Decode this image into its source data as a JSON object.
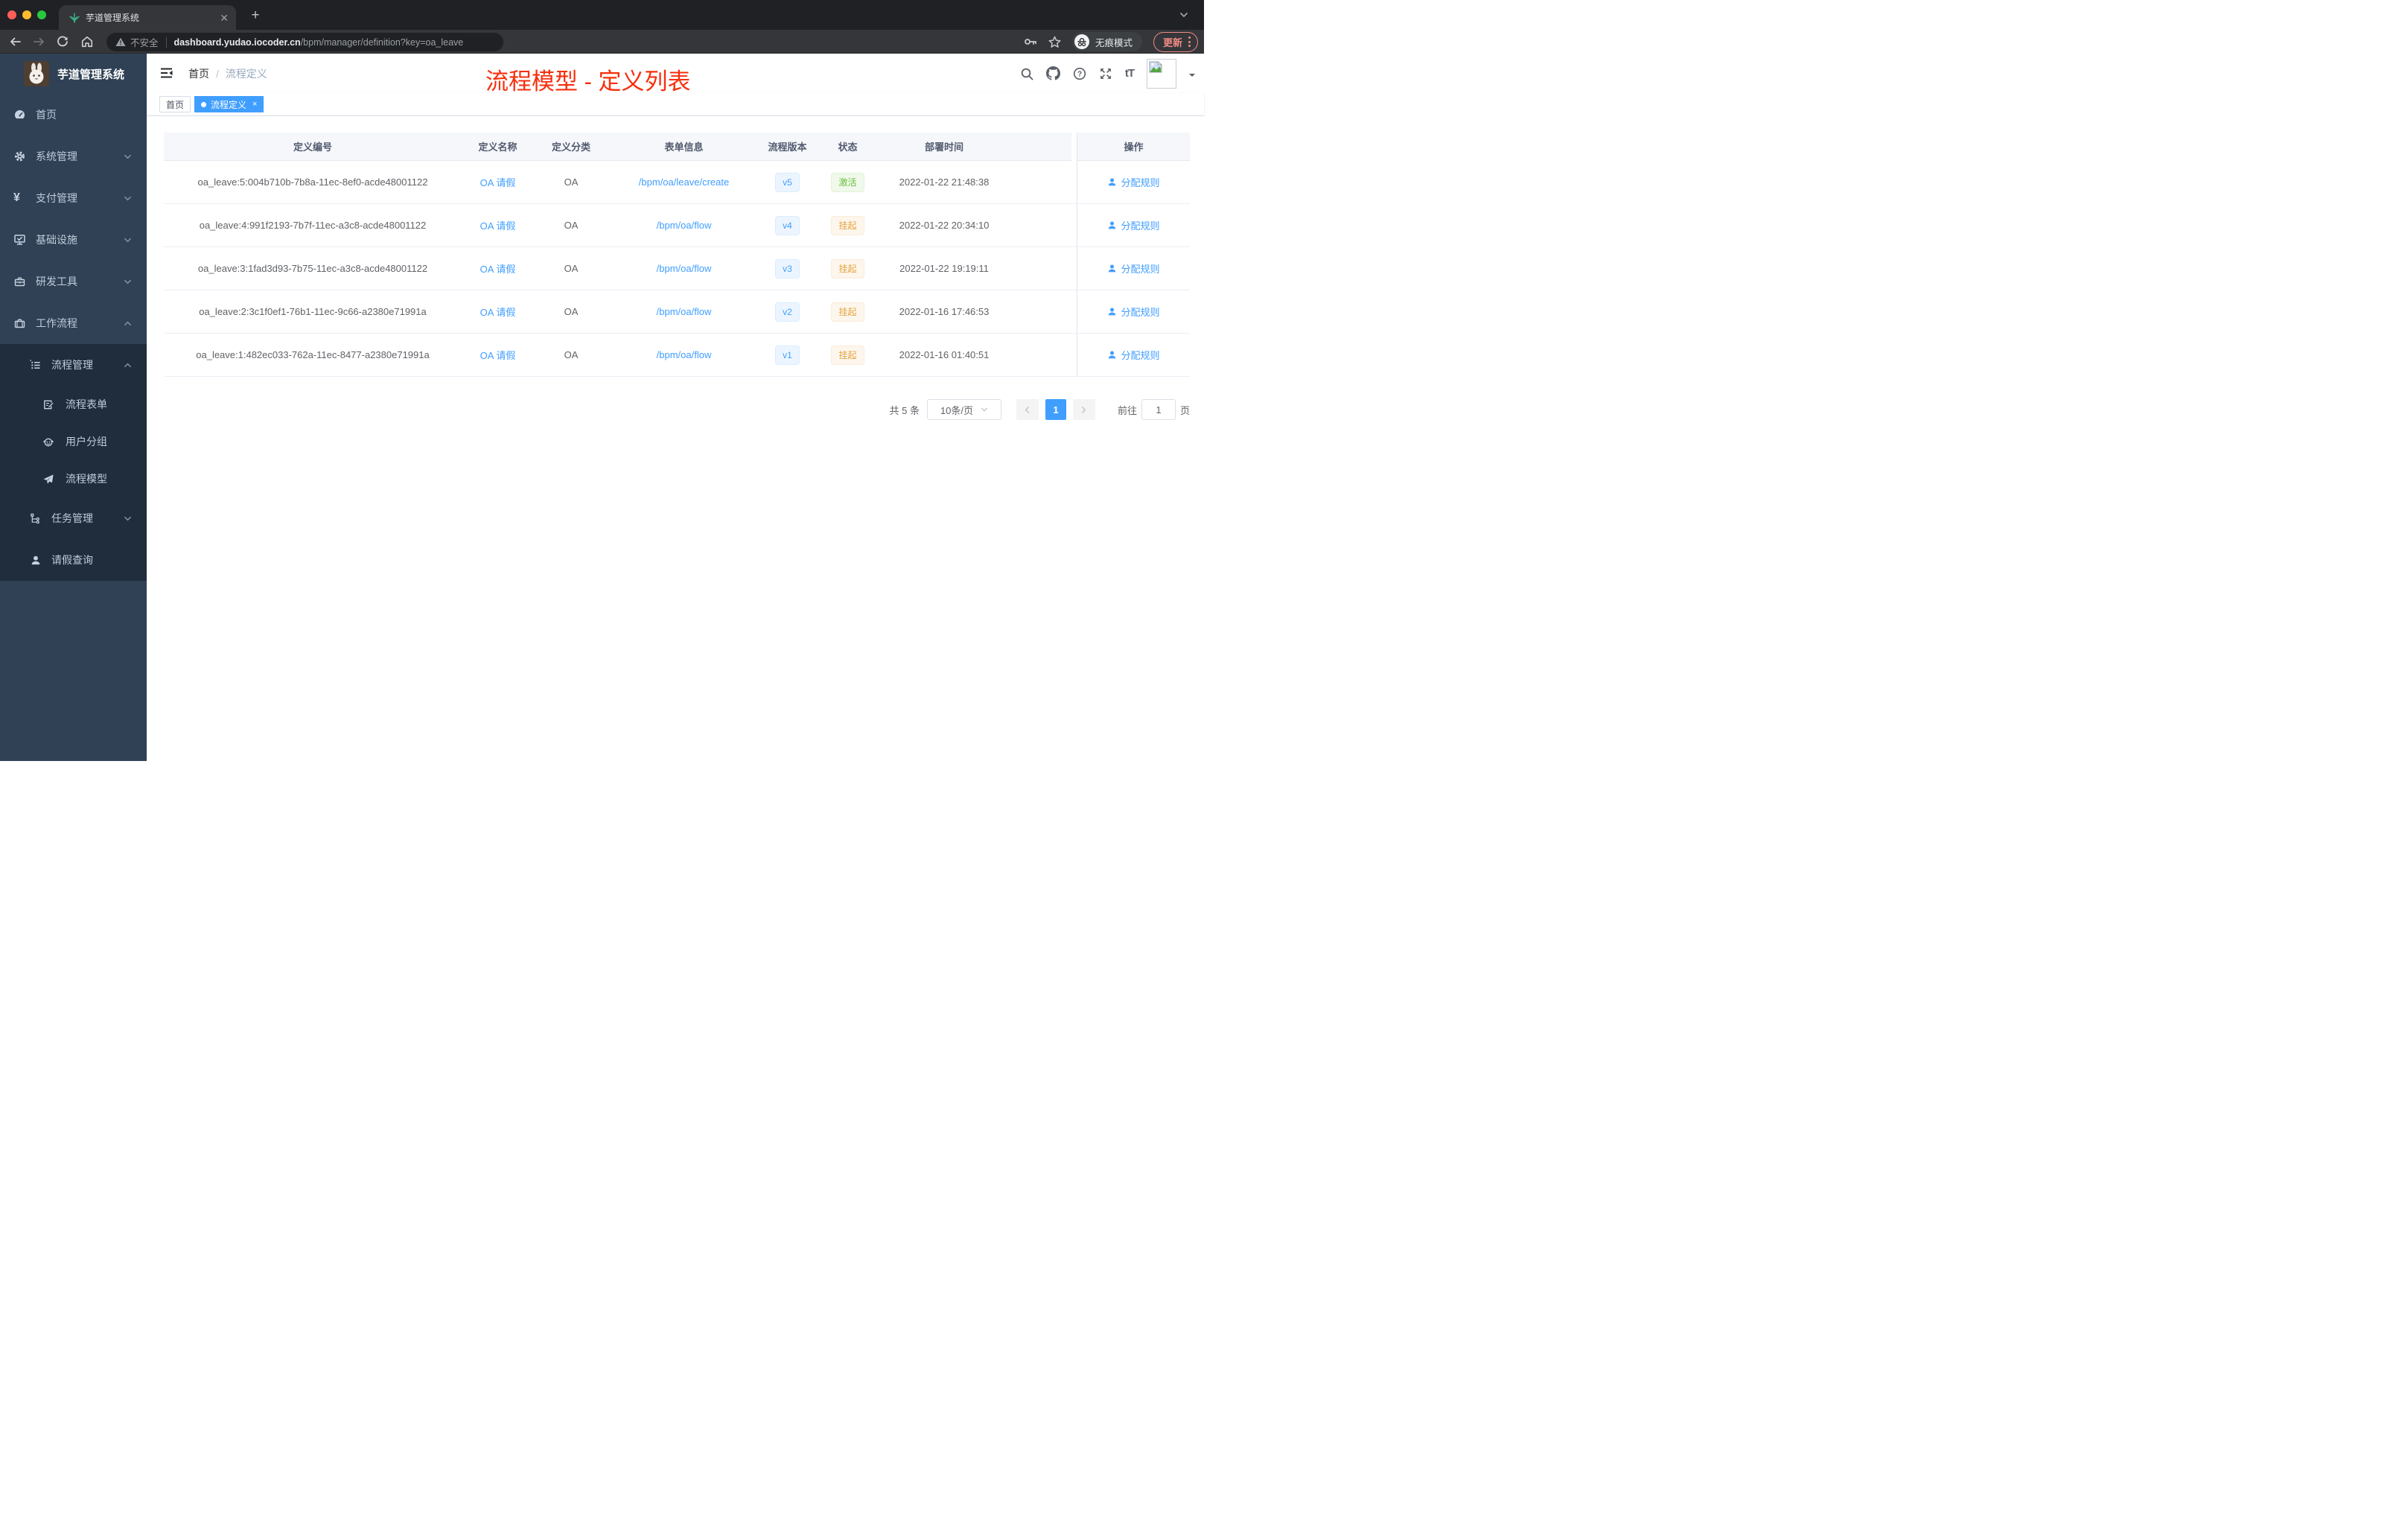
{
  "browser": {
    "tab_title": "芋道管理系统",
    "security_label": "不安全",
    "url_host": "dashboard.yudao.iocoder.cn",
    "url_path": "/bpm/manager/definition?key=oa_leave",
    "incognito_label": "无痕模式",
    "update_label": "更新"
  },
  "sidebar": {
    "app_title": "芋道管理系统",
    "items": [
      {
        "label": "首页",
        "icon": "dashboard-icon"
      },
      {
        "label": "系统管理",
        "icon": "gear-icon",
        "expand": "down"
      },
      {
        "label": "支付管理",
        "icon": "yen-icon",
        "expand": "down"
      },
      {
        "label": "基础设施",
        "icon": "monitor-check-icon",
        "expand": "down"
      },
      {
        "label": "研发工具",
        "icon": "toolbox-icon",
        "expand": "down"
      },
      {
        "label": "工作流程",
        "icon": "briefcase-icon",
        "expand": "up"
      },
      {
        "label": "流程管理",
        "icon": "list-icon",
        "expand": "up"
      },
      {
        "label": "流程表单",
        "icon": "form-edit-icon"
      },
      {
        "label": "用户分组",
        "icon": "robot-icon"
      },
      {
        "label": "流程模型",
        "icon": "paper-plane-icon"
      },
      {
        "label": "任务管理",
        "icon": "tree-icon",
        "expand": "down"
      },
      {
        "label": "请假查询",
        "icon": "user-icon"
      }
    ]
  },
  "navbar": {
    "breadcrumb": [
      "首页",
      "流程定义"
    ],
    "breadcrumb_separator": "/",
    "font_size_icon_label": "tT",
    "overlay_title": "流程模型 - 定义列表"
  },
  "tags": [
    {
      "label": "首页",
      "active": false
    },
    {
      "label": "流程定义",
      "active": true,
      "close": "×"
    }
  ],
  "table": {
    "columns": [
      "定义编号",
      "定义名称",
      "定义分类",
      "表单信息",
      "流程版本",
      "状态",
      "部署时间",
      "操作"
    ],
    "action_label": "分配规则",
    "rows": [
      {
        "id": "oa_leave:5:004b710b-7b8a-11ec-8ef0-acde48001122",
        "name": "OA 请假",
        "category": "OA",
        "form": "/bpm/oa/leave/create",
        "version": "v5",
        "status": "激活",
        "status_type": "success",
        "deployed": "2022-01-22 21:48:38"
      },
      {
        "id": "oa_leave:4:991f2193-7b7f-11ec-a3c8-acde48001122",
        "name": "OA 请假",
        "category": "OA",
        "form": "/bpm/oa/flow",
        "version": "v4",
        "status": "挂起",
        "status_type": "warning",
        "deployed": "2022-01-22 20:34:10"
      },
      {
        "id": "oa_leave:3:1fad3d93-7b75-11ec-a3c8-acde48001122",
        "name": "OA 请假",
        "category": "OA",
        "form": "/bpm/oa/flow",
        "version": "v3",
        "status": "挂起",
        "status_type": "warning",
        "deployed": "2022-01-22 19:19:11"
      },
      {
        "id": "oa_leave:2:3c1f0ef1-76b1-11ec-9c66-a2380e71991a",
        "name": "OA 请假",
        "category": "OA",
        "form": "/bpm/oa/flow",
        "version": "v2",
        "status": "挂起",
        "status_type": "warning",
        "deployed": "2022-01-16 17:46:53"
      },
      {
        "id": "oa_leave:1:482ec033-762a-11ec-8477-a2380e71991a",
        "name": "OA 请假",
        "category": "OA",
        "form": "/bpm/oa/flow",
        "version": "v1",
        "status": "挂起",
        "status_type": "warning",
        "deployed": "2022-01-16 01:40:51"
      }
    ]
  },
  "pagination": {
    "total": "共 5 条",
    "page_size": "10条/页",
    "current_page": "1",
    "goto_label": "前往",
    "goto_value": "1",
    "unit": "页"
  },
  "colors": {
    "accent": "#409eff",
    "success": "#67c23a",
    "warning": "#e6a23c",
    "sidebar_bg": "#304156",
    "submenu_bg": "#1f2d3d",
    "annotation_red": "#f62f0c"
  }
}
